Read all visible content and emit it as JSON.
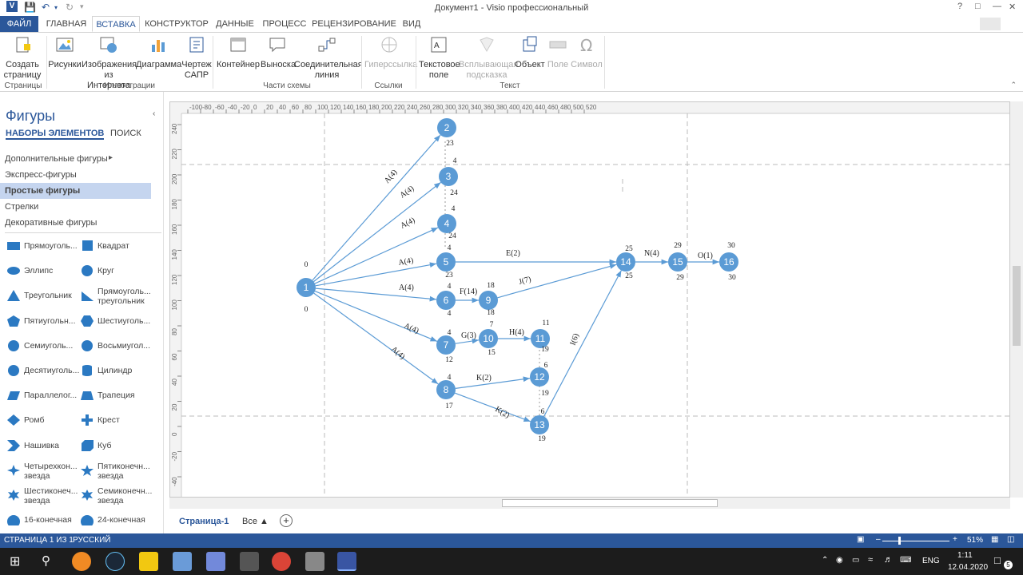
{
  "window": {
    "title": "Документ1 - Visio профессиональный"
  },
  "tabs": [
    {
      "label": "ФАЙЛ"
    },
    {
      "label": "ГЛАВНАЯ"
    },
    {
      "label": "ВСТАВКА"
    },
    {
      "label": "КОНСТРУКТОР"
    },
    {
      "label": "ДАННЫЕ"
    },
    {
      "label": "ПРОЦЕСС"
    },
    {
      "label": "РЕЦЕНЗИРОВАНИЕ"
    },
    {
      "label": "ВИД"
    }
  ],
  "ribbon": {
    "buttons": [
      {
        "label": "Создать страницу",
        "icon": "new-page-icon",
        "dropdown": true,
        "disabled": false
      },
      {
        "label": "Рисунки",
        "icon": "picture-icon",
        "dropdown": false,
        "disabled": false
      },
      {
        "label": "Изображения из Интернета",
        "icon": "online-picture-icon",
        "dropdown": false,
        "disabled": false
      },
      {
        "label": "Диаграмма",
        "icon": "chart-icon",
        "dropdown": false,
        "disabled": false
      },
      {
        "label": "Чертеж САПР",
        "icon": "cad-icon",
        "dropdown": false,
        "disabled": false
      },
      {
        "label": "Контейнер",
        "icon": "container-icon",
        "dropdown": true,
        "disabled": false
      },
      {
        "label": "Выноска",
        "icon": "callout-icon",
        "dropdown": true,
        "disabled": false
      },
      {
        "label": "Соединительная линия",
        "icon": "connector-icon",
        "dropdown": false,
        "disabled": false
      },
      {
        "label": "Гиперссылка",
        "icon": "hyperlink-icon",
        "dropdown": false,
        "disabled": true
      },
      {
        "label": "Текстовое поле",
        "icon": "textbox-icon",
        "dropdown": true,
        "disabled": false
      },
      {
        "label": "Всплывающая подсказка",
        "icon": "tooltip-icon",
        "dropdown": false,
        "disabled": true
      },
      {
        "label": "Объект",
        "icon": "object-icon",
        "dropdown": false,
        "disabled": false
      },
      {
        "label": "Поле",
        "icon": "field-icon",
        "dropdown": false,
        "disabled": true
      },
      {
        "label": "Символ",
        "icon": "omega-icon",
        "dropdown": true,
        "disabled": true
      }
    ],
    "groups": [
      {
        "label": "Страницы"
      },
      {
        "label": "Иллюстрации"
      },
      {
        "label": "Части схемы"
      },
      {
        "label": "Ссылки"
      },
      {
        "label": "Текст"
      }
    ]
  },
  "sidebar": {
    "title": "Фигуры",
    "tab_sets": "НАБОРЫ ЭЛЕМЕНТОВ",
    "tab_search": "ПОИСК",
    "stencils": [
      {
        "label": "Дополнительные фигуры",
        "selected": false
      },
      {
        "label": "Экспресс-фигуры",
        "selected": false
      },
      {
        "label": "Простые фигуры",
        "selected": true
      },
      {
        "label": "Стрелки",
        "selected": false
      },
      {
        "label": "Декоративные фигуры",
        "selected": false
      }
    ],
    "shapes": [
      {
        "label": "Прямоуголь...",
        "icon": "rectangle-icon"
      },
      {
        "label": "Квадрат",
        "icon": "square-icon"
      },
      {
        "label": "Эллипс",
        "icon": "ellipse-icon"
      },
      {
        "label": "Круг",
        "icon": "circle-icon"
      },
      {
        "label": "Треугольник",
        "icon": "triangle-icon"
      },
      {
        "label": "Прямоуголь... треугольник",
        "icon": "right-triangle-icon"
      },
      {
        "label": "Пятиугольн...",
        "icon": "pentagon-icon"
      },
      {
        "label": "Шестиуголь...",
        "icon": "hexagon-icon"
      },
      {
        "label": "Семиуголь...",
        "icon": "heptagon-icon"
      },
      {
        "label": "Восьмиугол...",
        "icon": "octagon-icon"
      },
      {
        "label": "Десятиуголь...",
        "icon": "decagon-icon"
      },
      {
        "label": "Цилиндр",
        "icon": "cylinder-icon"
      },
      {
        "label": "Параллелог...",
        "icon": "parallelogram-icon"
      },
      {
        "label": "Трапеция",
        "icon": "trapezoid-icon"
      },
      {
        "label": "Ромб",
        "icon": "diamond-icon"
      },
      {
        "label": "Крест",
        "icon": "cross-icon"
      },
      {
        "label": "Нашивка",
        "icon": "chevron-icon"
      },
      {
        "label": "Куб",
        "icon": "cube-icon"
      },
      {
        "label": "Четырехкон... звезда",
        "icon": "star4-icon"
      },
      {
        "label": "Пятиконечн... звезда",
        "icon": "star5-icon"
      },
      {
        "label": "Шестиконеч... звезда",
        "icon": "star6-icon"
      },
      {
        "label": "Семиконечн... звезда",
        "icon": "star7-icon"
      },
      {
        "label": "16-конечная",
        "icon": "star16-icon"
      },
      {
        "label": "24-конечная",
        "icon": "star24-icon"
      }
    ]
  },
  "ruler": {
    "h_ticks": [
      "-100",
      "-80",
      "-60",
      "-40",
      "-20",
      "0",
      "20",
      "40",
      "60",
      "80",
      "100",
      "120",
      "140",
      "160",
      "180",
      "200",
      "220",
      "240",
      "260",
      "280",
      "300",
      "320",
      "340",
      "360",
      "380",
      "400",
      "420",
      "440",
      "460",
      "480",
      "500",
      "520"
    ],
    "v_ticks": [
      "240",
      "220",
      "200",
      "180",
      "160",
      "140",
      "120",
      "100",
      "80",
      "60",
      "40",
      "20",
      "0",
      "-20",
      "-40"
    ]
  },
  "diagram": {
    "nodes": [
      {
        "id": "1",
        "early": "0",
        "late": "0"
      },
      {
        "id": "2",
        "early": "",
        "late": "23"
      },
      {
        "id": "3",
        "early": "4",
        "late": "24"
      },
      {
        "id": "4",
        "early": "4",
        "late": "24"
      },
      {
        "id": "5",
        "early": "4",
        "late": "23"
      },
      {
        "id": "6",
        "early": "4",
        "late": "4"
      },
      {
        "id": "7",
        "early": "4",
        "late": "12"
      },
      {
        "id": "8",
        "early": "4",
        "late": "17"
      },
      {
        "id": "9",
        "early": "18",
        "late": "18"
      },
      {
        "id": "10",
        "early": "7",
        "late": "15"
      },
      {
        "id": "11",
        "early": "11",
        "late": "19"
      },
      {
        "id": "12",
        "early": "6",
        "late": "19"
      },
      {
        "id": "13",
        "early": "6",
        "late": "19"
      },
      {
        "id": "14",
        "early": "25",
        "late": "25"
      },
      {
        "id": "15",
        "early": "29",
        "late": "29"
      },
      {
        "id": "16",
        "early": "30",
        "late": "30"
      }
    ],
    "edges": [
      {
        "from": "1",
        "to": "2",
        "label": "A(4)"
      },
      {
        "from": "1",
        "to": "3",
        "label": "A(4)"
      },
      {
        "from": "1",
        "to": "4",
        "label": "A(4)"
      },
      {
        "from": "1",
        "to": "5",
        "label": "A(4)"
      },
      {
        "from": "1",
        "to": "6",
        "label": "A(4)"
      },
      {
        "from": "1",
        "to": "7",
        "label": "A(4)"
      },
      {
        "from": "1",
        "to": "8",
        "label": "A(4)"
      },
      {
        "from": "5",
        "to": "14",
        "label": "E(2)"
      },
      {
        "from": "6",
        "to": "9",
        "label": "F(14)"
      },
      {
        "from": "9",
        "to": "14",
        "label": "J(7)"
      },
      {
        "from": "7",
        "to": "10",
        "label": "G(3)"
      },
      {
        "from": "10",
        "to": "11",
        "label": "H(4)"
      },
      {
        "from": "8",
        "to": "12",
        "label": "K(2)"
      },
      {
        "from": "8",
        "to": "13",
        "label": "K(2)"
      },
      {
        "from": "13",
        "to": "14",
        "label": "I(6)"
      },
      {
        "from": "14",
        "to": "15",
        "label": "N(4)"
      },
      {
        "from": "15",
        "to": "16",
        "label": "O(1)"
      }
    ],
    "node_color": "#5b9bd5",
    "edge_color": "#5b9bd5"
  },
  "page_tabs": {
    "current": "Страница-1",
    "all": "Все"
  },
  "status": {
    "page": "СТРАНИЦА 1 ИЗ 1",
    "language": "РУССКИЙ",
    "zoom": "51%"
  },
  "taskbar": {
    "lang": "ENG",
    "time": "1:11",
    "date": "12.04.2020",
    "notif_count": "5"
  },
  "colors": {
    "accent": "#2b579a"
  }
}
